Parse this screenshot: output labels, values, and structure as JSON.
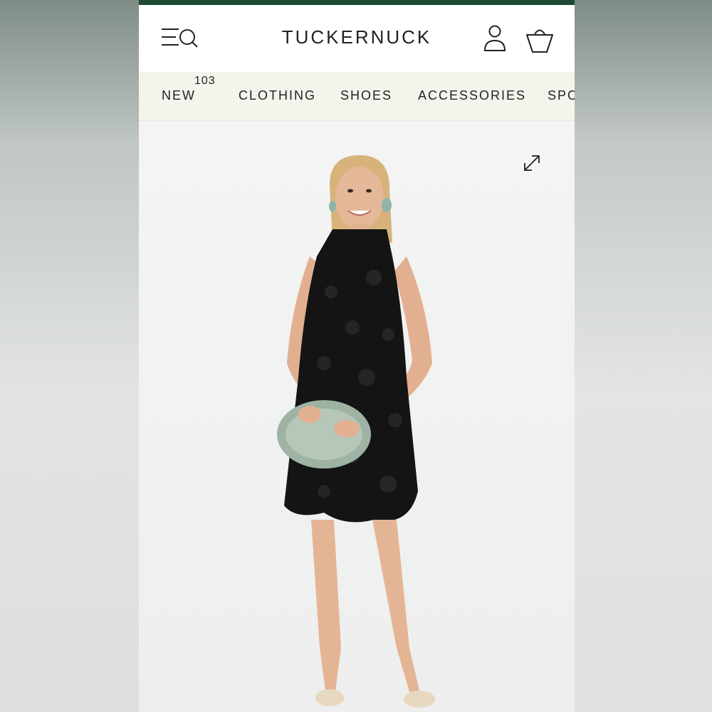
{
  "header": {
    "logo": "TUCKERNUCK"
  },
  "nav": {
    "items": [
      {
        "label": "NEW",
        "badge": "103"
      },
      {
        "label": "CLOTHING"
      },
      {
        "label": "SHOES"
      },
      {
        "label": "ACCESSORIES"
      },
      {
        "label": "SPO"
      }
    ]
  },
  "icons": {
    "menu_search": "menu-search-icon",
    "account": "user-icon",
    "bag": "shopping-bag-icon",
    "expand": "expand-icon"
  },
  "colors": {
    "top_bar": "#1d4a35",
    "nav_background": "#f4f3ec",
    "text": "#222222"
  }
}
